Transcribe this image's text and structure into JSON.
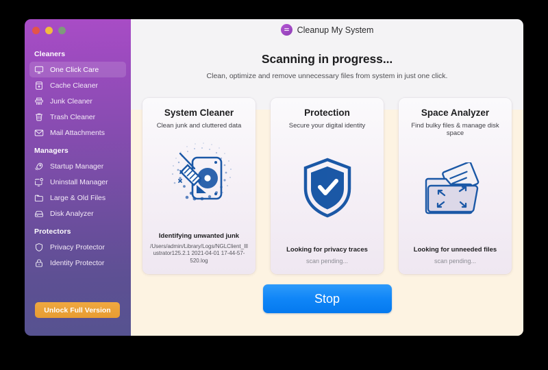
{
  "window": {
    "traffic_lights": [
      {
        "name": "close",
        "color": "#e3544a"
      },
      {
        "name": "minimize",
        "color": "#f2bb3f"
      },
      {
        "name": "zoom",
        "color": "#7f9a7c"
      }
    ]
  },
  "sidebar": {
    "groups": [
      {
        "title": "Cleaners",
        "items": [
          {
            "label": "One Click Care",
            "icon": "monitor-icon",
            "active": true
          },
          {
            "label": "Cache Cleaner",
            "icon": "cache-box-icon",
            "active": false
          },
          {
            "label": "Junk Cleaner",
            "icon": "shredder-icon",
            "active": false
          },
          {
            "label": "Trash Cleaner",
            "icon": "trash-icon",
            "active": false
          },
          {
            "label": "Mail Attachments",
            "icon": "envelope-icon",
            "active": false
          }
        ]
      },
      {
        "title": "Managers",
        "items": [
          {
            "label": "Startup Manager",
            "icon": "rocket-icon",
            "active": false
          },
          {
            "label": "Uninstall Manager",
            "icon": "monitor-badge-icon",
            "active": false
          },
          {
            "label": "Large & Old Files",
            "icon": "folder-icon",
            "active": false
          },
          {
            "label": "Disk Analyzer",
            "icon": "disk-drive-icon",
            "active": false
          }
        ]
      },
      {
        "title": "Protectors",
        "items": [
          {
            "label": "Privacy Protector",
            "icon": "shield-icon",
            "active": false
          },
          {
            "label": "Identity Protector",
            "icon": "lock-icon",
            "active": false
          }
        ]
      }
    ],
    "unlock_button": "Unlock Full Version",
    "accent_top": "#a94cc6",
    "accent_bottom": "#565290",
    "unlock_color": "#e89c32"
  },
  "header": {
    "app_title": "Cleanup My System",
    "brand_icon": "app-logo-icon"
  },
  "main": {
    "headline": "Scanning in progress...",
    "subheadline": "Clean, optimize and remove unnecessary files from system in just one click.",
    "stop_button": "Stop",
    "stop_button_color": "#0f86f6",
    "cards": [
      {
        "title": "System Cleaner",
        "subtitle": "Clean junk and cluttered data",
        "art": "broom-disk-icon",
        "status": "Identifying unwanted junk",
        "detail": "/Users/admin/Library/Logs/NGLClient_Illustrator125.2.1 2021-04-01 17-44-57-520.log",
        "pending": false
      },
      {
        "title": "Protection",
        "subtitle": "Secure your digital identity",
        "art": "shield-check-icon",
        "status": "Looking for privacy traces",
        "detail": "scan pending...",
        "pending": true
      },
      {
        "title": "Space Analyzer",
        "subtitle": "Find bulky files & manage disk space",
        "art": "folder-expand-icon",
        "status": "Looking for unneeded files",
        "detail": "scan pending...",
        "pending": true
      }
    ]
  }
}
